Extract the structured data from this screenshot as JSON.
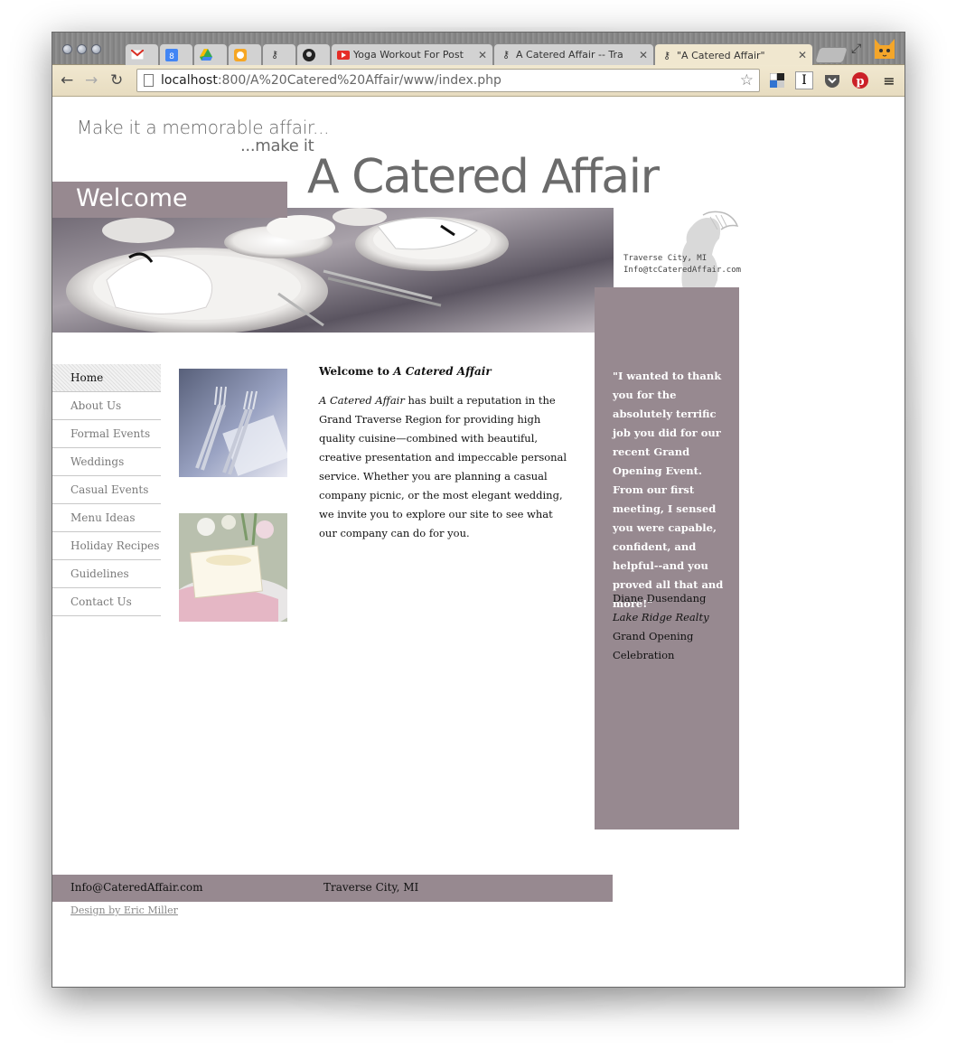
{
  "browser": {
    "tabs": [
      {
        "title": "",
        "icon": "gmail-icon",
        "closable": false
      },
      {
        "title": "",
        "icon": "calendar-icon",
        "closable": false
      },
      {
        "title": "",
        "icon": "drive-icon",
        "closable": false
      },
      {
        "title": "",
        "icon": "orange-app-icon",
        "closable": false
      },
      {
        "title": "",
        "icon": "key-icon",
        "closable": false
      },
      {
        "title": "",
        "icon": "github-icon",
        "closable": false
      },
      {
        "title": "Yoga Workout For Post",
        "icon": "youtube-icon",
        "closable": true
      },
      {
        "title": "A Catered Affair -- Tra",
        "icon": "key-icon",
        "closable": true
      },
      {
        "title": "\"A Catered Affair\"",
        "icon": "key-icon",
        "closable": true,
        "active": true
      }
    ],
    "url_host": "localhost",
    "url_rest": ":800/A%20Catered%20Affair/www/index.php",
    "extensions": [
      "delicious-icon",
      "instapaper-icon",
      "pocket-icon",
      "pinterest-icon",
      "menu-icon"
    ]
  },
  "site": {
    "tagline_line1": "Make it a memorable affair...",
    "tagline_line2": "...make it",
    "title": "A Catered Affair",
    "section_label": "Welcome",
    "contact_location": "Traverse City, MI",
    "contact_email": "Info@tcCateredAffair.com"
  },
  "nav": {
    "items": [
      "Home",
      "About Us",
      "Formal Events",
      "Weddings",
      "Casual Events",
      "Menu Ideas",
      "Holiday Recipes",
      "Guidelines",
      "Contact Us"
    ],
    "current": "Home"
  },
  "main": {
    "heading_prefix": "Welcome to",
    "heading_emph": "A Catered Affair",
    "body_emph": "A Catered Affair",
    "body": " has built a reputation in the Grand Traverse Region for providing high quality cuisine—combined with beautiful, creative presentation and impeccable personal service. Whether you are planning a casual company picnic, or the most elegant wedding, we invite you to explore our site to see what our company can do for you."
  },
  "testimonial": {
    "quote": "\"I wanted to thank you for the absolutely terrific job you did for our recent Grand Opening Event. From our first meeting, I sensed you were capable, confident, and helpful--and you proved all that and more!\"",
    "author": "Diane Dusendang",
    "company": "Lake Ridge Realty",
    "event": "Grand Opening Celebration"
  },
  "footer": {
    "email": "Info@CateredAffair.com",
    "location": "Traverse City, MI",
    "credit": "Design by Eric Miller"
  },
  "colors": {
    "accent": "#978990",
    "text": "#111111",
    "muted": "#7a7a7a"
  }
}
